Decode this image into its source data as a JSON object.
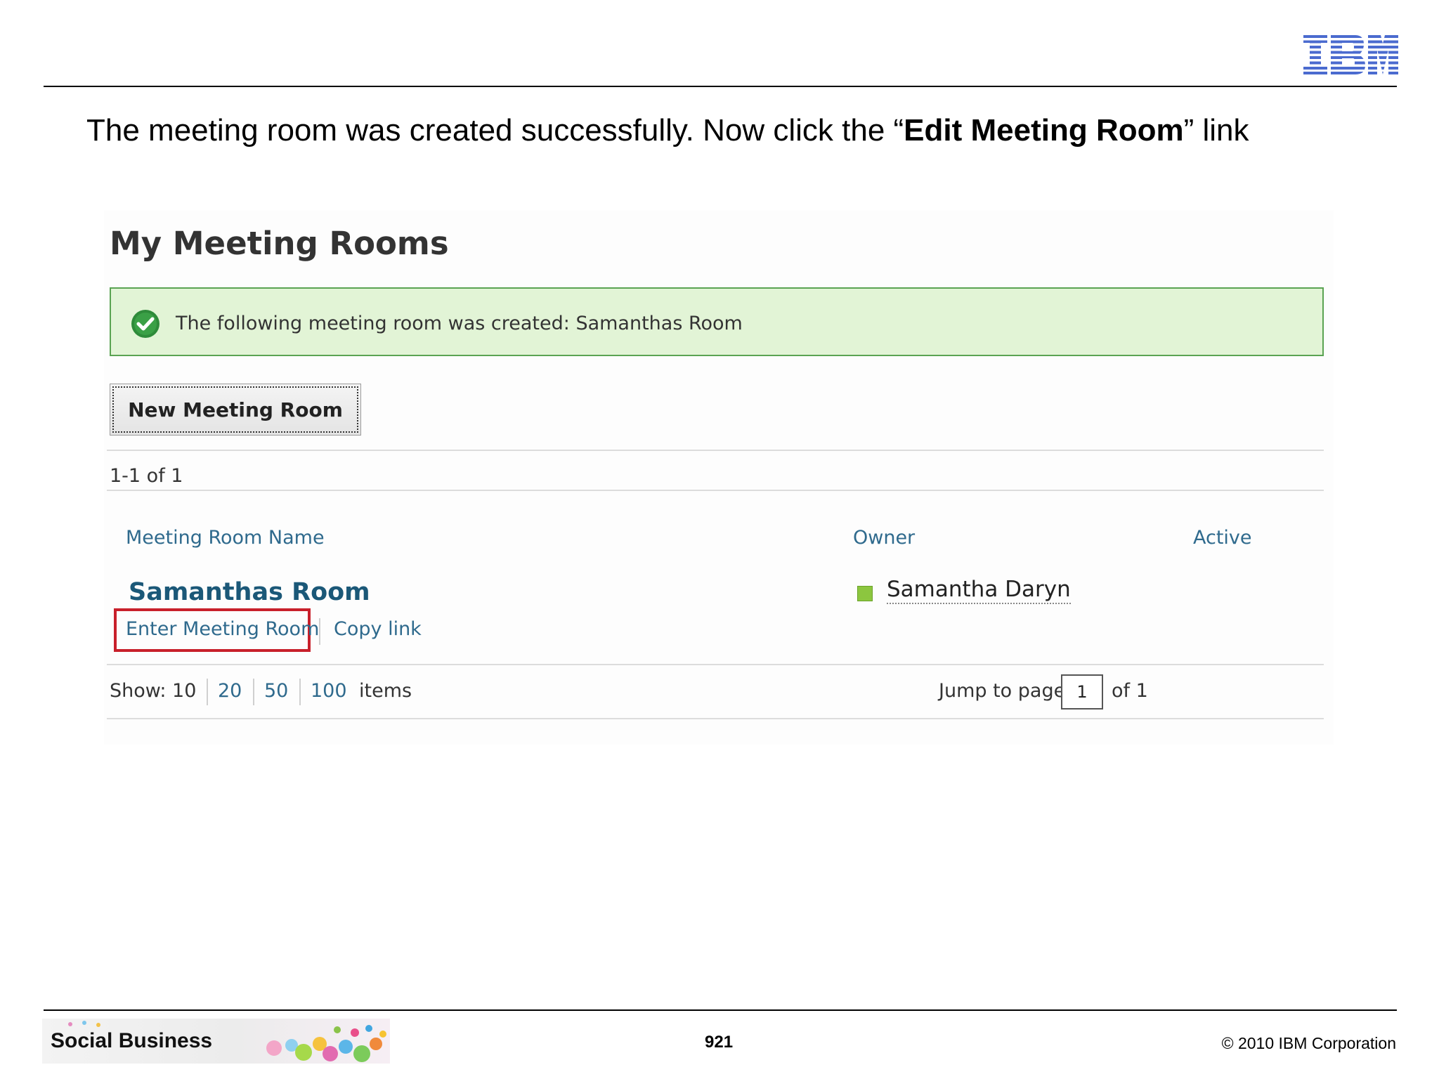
{
  "slide": {
    "logo_text": "IBM",
    "instruction_pre": "The meeting room was created successfully. Now click the “",
    "instruction_bold": "Edit Meeting Room",
    "instruction_post": "” link"
  },
  "screen": {
    "title": "My Meeting Rooms",
    "success_message": "The following meeting room was created: Samanthas Room",
    "new_room_button": "New Meeting Room",
    "result_count": "1-1 of 1",
    "columns": {
      "name": "Meeting Room Name",
      "owner": "Owner",
      "active": "Active"
    },
    "rows": [
      {
        "room_name": "Samanthas Room",
        "enter_link": "Enter Meeting Room",
        "copy_link": "Copy link",
        "owner": "Samantha Daryn"
      }
    ],
    "paging": {
      "show_label": "Show: 10",
      "options": [
        "20",
        "50",
        "100"
      ],
      "items_label": "items",
      "jump_label": "Jump to page",
      "page_value": "1",
      "of_label": "of 1"
    }
  },
  "footer": {
    "brand": "Social Business",
    "page_number": "921",
    "copyright": "© 2010 IBM Corporation"
  },
  "colors": {
    "link": "#2f6a8d",
    "room_name": "#1b5878",
    "success_bg": "#e2f4d6",
    "success_border": "#5aa352",
    "highlight": "#c8202b",
    "logo": "#4b6bcf"
  },
  "icons": [
    "ibm-logo",
    "success-check-icon",
    "presence-available-icon"
  ]
}
